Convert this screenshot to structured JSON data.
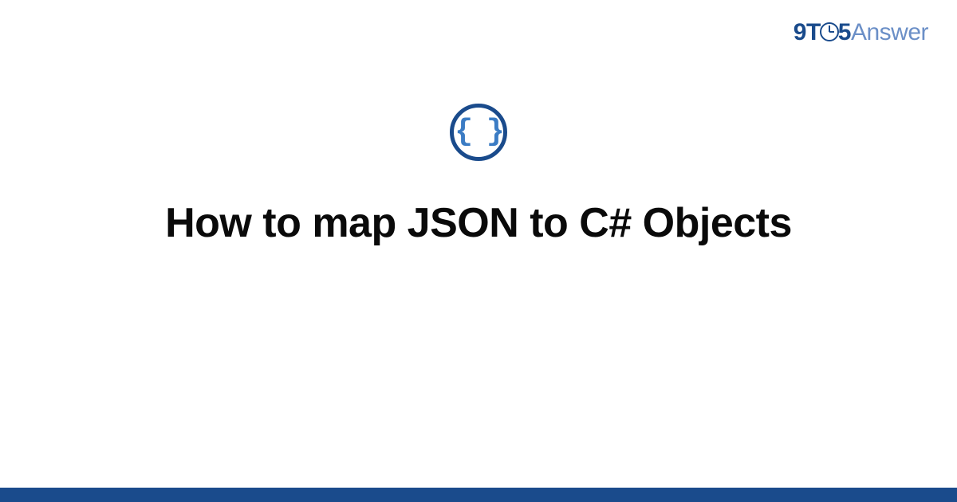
{
  "logo": {
    "nine": "9",
    "t": "T",
    "five": "5",
    "answer": "Answer"
  },
  "icon": {
    "braces": "{ }"
  },
  "title": "How to map JSON to C# Objects",
  "colors": {
    "primary": "#1a4b8c",
    "secondary": "#6b8fc7",
    "accent": "#3b7cc4"
  }
}
